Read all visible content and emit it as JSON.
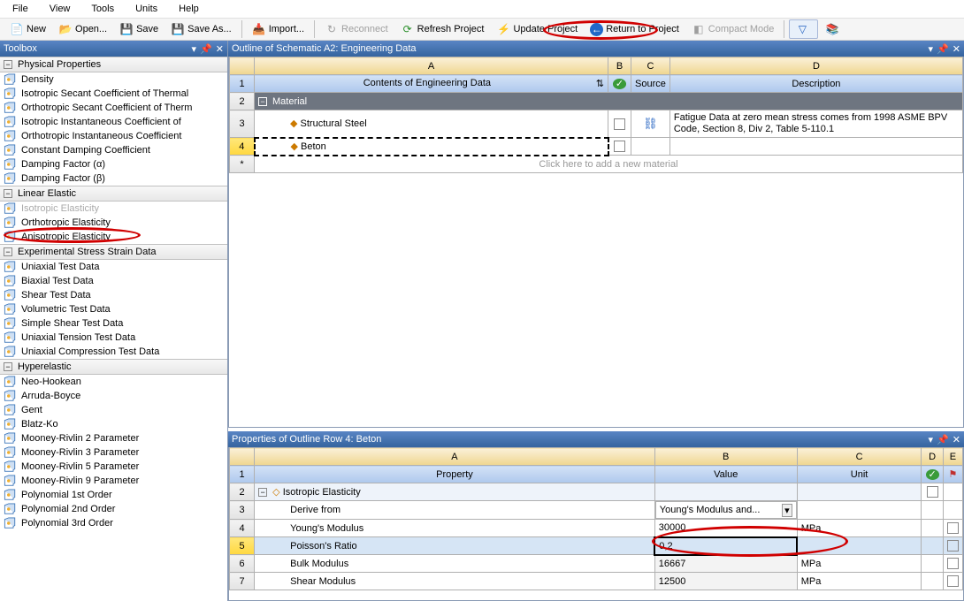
{
  "menu": {
    "file": "File",
    "view": "View",
    "tools": "Tools",
    "units": "Units",
    "help": "Help"
  },
  "toolbar": {
    "new": "New",
    "open": "Open...",
    "save": "Save",
    "saveas": "Save As...",
    "import": "Import...",
    "reconnect": "Reconnect",
    "refresh": "Refresh Project",
    "update": "Update Project",
    "return": "Return to Project",
    "compact": "Compact Mode"
  },
  "toolbox": {
    "title": "Toolbox",
    "groups": [
      {
        "label": "Physical Properties",
        "items": [
          {
            "t": "Density"
          },
          {
            "t": "Isotropic Secant Coefficient of Thermal"
          },
          {
            "t": "Orthotropic Secant Coefficient of Therm"
          },
          {
            "t": "Isotropic Instantaneous Coefficient of"
          },
          {
            "t": "Orthotropic Instantaneous Coefficient"
          },
          {
            "t": "Constant Damping Coefficient"
          },
          {
            "t": "Damping Factor (α)"
          },
          {
            "t": "Damping Factor (β)"
          }
        ]
      },
      {
        "label": "Linear Elastic",
        "items": [
          {
            "t": "Isotropic Elasticity",
            "dim": true
          },
          {
            "t": "Orthotropic Elasticity"
          },
          {
            "t": "Anisotropic Elasticity"
          }
        ]
      },
      {
        "label": "Experimental Stress Strain Data",
        "items": [
          {
            "t": "Uniaxial Test Data"
          },
          {
            "t": "Biaxial Test Data"
          },
          {
            "t": "Shear Test Data"
          },
          {
            "t": "Volumetric Test Data"
          },
          {
            "t": "Simple Shear Test Data"
          },
          {
            "t": "Uniaxial Tension Test Data"
          },
          {
            "t": "Uniaxial Compression Test Data"
          }
        ]
      },
      {
        "label": "Hyperelastic",
        "items": [
          {
            "t": "Neo-Hookean"
          },
          {
            "t": "Arruda-Boyce"
          },
          {
            "t": "Gent"
          },
          {
            "t": "Blatz-Ko"
          },
          {
            "t": "Mooney-Rivlin 2 Parameter"
          },
          {
            "t": "Mooney-Rivlin 3 Parameter"
          },
          {
            "t": "Mooney-Rivlin 5 Parameter"
          },
          {
            "t": "Mooney-Rivlin 9 Parameter"
          },
          {
            "t": "Polynomial 1st Order"
          },
          {
            "t": "Polynomial 2nd Order"
          },
          {
            "t": "Polynomial 3rd Order"
          }
        ]
      }
    ]
  },
  "outline": {
    "title": "Outline of Schematic A2: Engineering Data",
    "colA": "A",
    "colB": "B",
    "colC": "C",
    "colD": "D",
    "hdr_contents": "Contents of Engineering Data",
    "hdr_source": "Source",
    "hdr_desc": "Description",
    "mat_label": "Material",
    "row3_label": "Structural Steel",
    "row3_desc": "Fatigue Data at zero mean stress comes from 1998 ASME BPV Code, Section 8, Div 2, Table 5-110.1",
    "row4_label": "Beton",
    "row_add": "Click here to add a new material"
  },
  "props": {
    "title": "Properties of Outline Row 4: Beton",
    "colA": "A",
    "colB": "B",
    "colC": "C",
    "colD": "D",
    "colE": "E",
    "hdr_prop": "Property",
    "hdr_val": "Value",
    "hdr_unit": "Unit",
    "r2": "Isotropic Elasticity",
    "r3p": "Derive from",
    "r3v": "Young's Modulus and...",
    "r4p": "Young's Modulus",
    "r4v": "30000",
    "r4u": "MPa",
    "r5p": "Poisson's Ratio",
    "r5v": "0,2",
    "r6p": "Bulk Modulus",
    "r6v": "16667",
    "r6u": "MPa",
    "r7p": "Shear Modulus",
    "r7v": "12500",
    "r7u": "MPa"
  },
  "rownums": {
    "r1": "1",
    "r2": "2",
    "r3": "3",
    "r4": "4",
    "r5": "5",
    "r6": "6",
    "r7": "7",
    "star": "*"
  }
}
